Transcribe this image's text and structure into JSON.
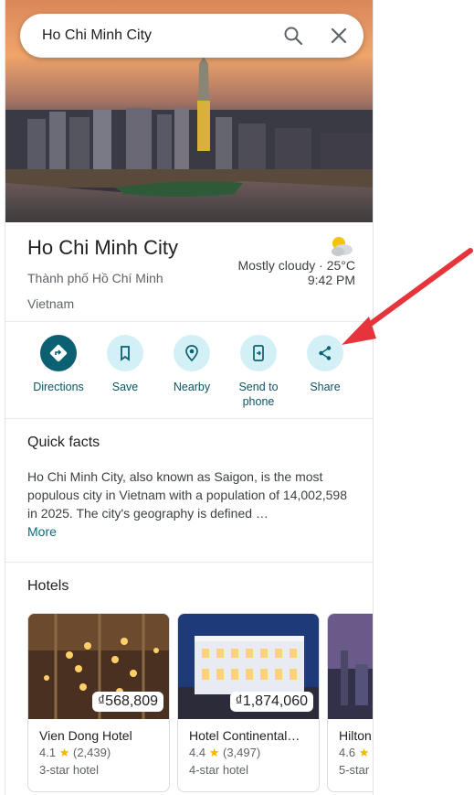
{
  "search": {
    "query": "Ho Chi Minh City"
  },
  "place": {
    "title": "Ho Chi Minh City",
    "local_name": "Thành phố Hồ Chí Minh",
    "country": "Vietnam"
  },
  "weather": {
    "summary": "Mostly cloudy · 25°C",
    "time": "9:42 PM",
    "icon": "partly-cloudy-night-icon"
  },
  "actions": [
    {
      "label": "Directions",
      "icon": "directions-icon"
    },
    {
      "label": "Save",
      "icon": "bookmark-icon"
    },
    {
      "label": "Nearby",
      "icon": "nearby-icon"
    },
    {
      "label": "Send to phone",
      "icon": "send-to-phone-icon"
    },
    {
      "label": "Share",
      "icon": "share-icon"
    }
  ],
  "quick_facts": {
    "title": "Quick facts",
    "text": "Ho Chi Minh City, also known as Saigon, is the most populous city in Vietnam with a population of 14,002,598 in 2025. The city's geography is defined …",
    "more_label": "More"
  },
  "hotels": {
    "title": "Hotels",
    "items": [
      {
        "name": "Vien Dong Hotel",
        "price": "₫568,809",
        "rating": "4.1",
        "reviews": "(2,439)",
        "class": "3-star hotel"
      },
      {
        "name": "Hotel Continental…",
        "price": "₫1,874,060",
        "rating": "4.4",
        "reviews": "(3,497)",
        "class": "4-star hotel"
      },
      {
        "name": "Hilton",
        "price": "",
        "rating": "4.6",
        "reviews": "",
        "class": "5-star"
      }
    ]
  },
  "colors": {
    "accent": "#0b6171",
    "action_bg": "#d3f0f7",
    "annotation_arrow": "#e5343c",
    "star": "#f6b400"
  }
}
